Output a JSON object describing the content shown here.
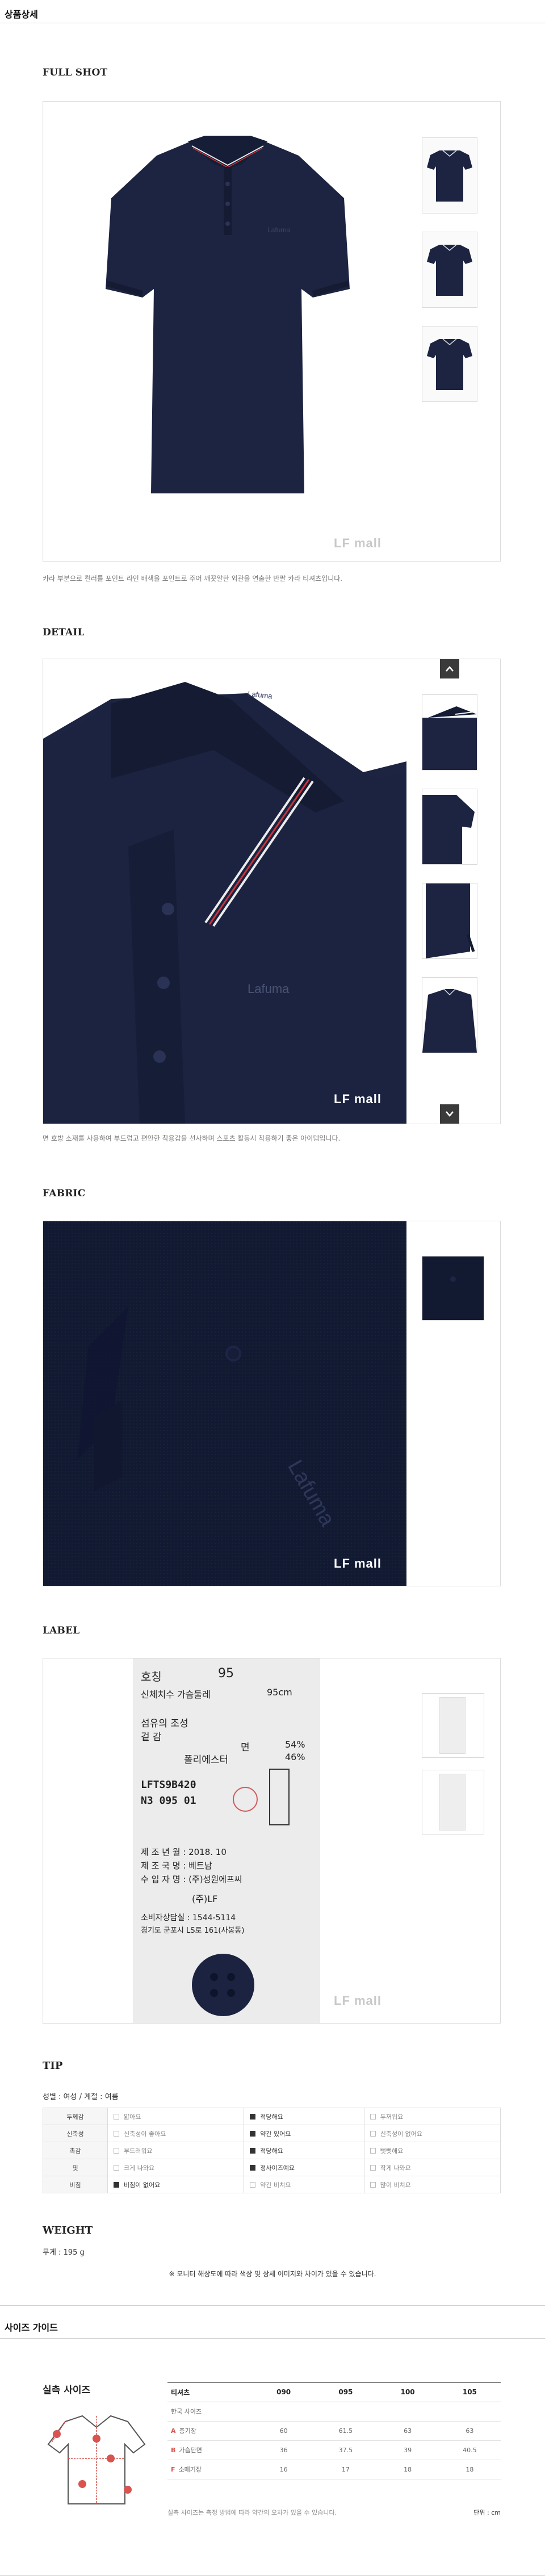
{
  "detail_section": {
    "title": "상품상세"
  },
  "full_shot": {
    "heading": "FULL SHOT",
    "caption": "카라 부분으로 컬러를 포인트 라인 배색을 포인트로 주어 깨끗알한 외관을 연출한 반팔 카라 티셔츠입니다.",
    "watermark": "LF mall"
  },
  "detail": {
    "heading": "DETAIL",
    "caption": "면 호방 소재를 사용하여 부드럽고 편안한 착용감을 선사하며 스포츠 활동시 착용하기 좋은 아이템입니다.",
    "watermark": "LF mall",
    "brand_print": "Lafuma",
    "up_icon": "chevron-up-icon",
    "down_icon": "chevron-down-icon"
  },
  "fabric": {
    "heading": "FABRIC",
    "watermark": "LF mall",
    "brand_print": "Lafuma"
  },
  "label": {
    "heading": "LABEL",
    "watermark": "LF mall",
    "tag_lines": {
      "size_left": "호칭",
      "size_right": "95",
      "body_left": "신체치수 가슴둘레",
      "body_right": "95cm",
      "fiber": "섬유의 조성",
      "shell": "겉 감",
      "cotton": "면",
      "cotton_pct": "54%",
      "poly": "폴리에스터",
      "poly_pct": "46%",
      "code1": "LFTS9B420",
      "code2": "N3 095 01",
      "made_date": "제 조 년 월 : 2018. 10",
      "made_country": "제 조 국 명 : 베트남",
      "importer": "수 입 자 명 : (주)성원에프씨",
      "brand": "(주)LF",
      "cs": "소비자상담실 : 1544-5114",
      "addr": "경기도 군포시 LS로 161(사봉동)"
    }
  },
  "tip": {
    "title": "TIP",
    "meta": "성별 : 여성 / 계절 : 여름",
    "rows": [
      {
        "label": "두께감",
        "opts": [
          "얇아요",
          "적당해요",
          "두꺼워요"
        ],
        "on": 1
      },
      {
        "label": "신축성",
        "opts": [
          "신축성이 좋아요",
          "약간 있어요",
          "신축성이 없어요"
        ],
        "on": 1
      },
      {
        "label": "촉감",
        "opts": [
          "부드러워요",
          "적당해요",
          "뻣뻣해요"
        ],
        "on": 1
      },
      {
        "label": "핏",
        "opts": [
          "크게 나와요",
          "정사이즈예요",
          "작게 나와요"
        ],
        "on": 1
      },
      {
        "label": "비침",
        "opts": [
          "비침이 없어요",
          "약간 비쳐요",
          "많이 비쳐요"
        ],
        "on": 0
      }
    ]
  },
  "weight": {
    "title": "WEIGHT",
    "value": "무게 : 195 g"
  },
  "notice": "※ 모니터 해상도에 따라 색상 및 상세 이미지와 차이가 있을 수 있습니다.",
  "size_guide": {
    "section_title": "사이즈 가이드",
    "heading": "실측 사이즈",
    "head_cells": [
      "티셔츠",
      "090",
      "095",
      "100",
      "105"
    ],
    "subhead": "한국 사이즈",
    "rows": [
      {
        "letter": "A",
        "label": "총기장",
        "values": [
          "60",
          "61.5",
          "63",
          "63"
        ]
      },
      {
        "letter": "B",
        "label": "가슴단면",
        "values": [
          "36",
          "37.5",
          "39",
          "40.5"
        ]
      },
      {
        "letter": "F",
        "label": "소매기장",
        "values": [
          "16",
          "17",
          "18",
          "18"
        ]
      }
    ],
    "note": "실측 사이즈는 측정 방법에 따라 약간의 오차가 있을 수 있습니다.",
    "unit": "단위 : cm"
  },
  "colors": {
    "navy": "#1b2340",
    "navy_dark": "#121a32",
    "stripe_red": "#c8343a",
    "rule": "#cfcfcf"
  }
}
